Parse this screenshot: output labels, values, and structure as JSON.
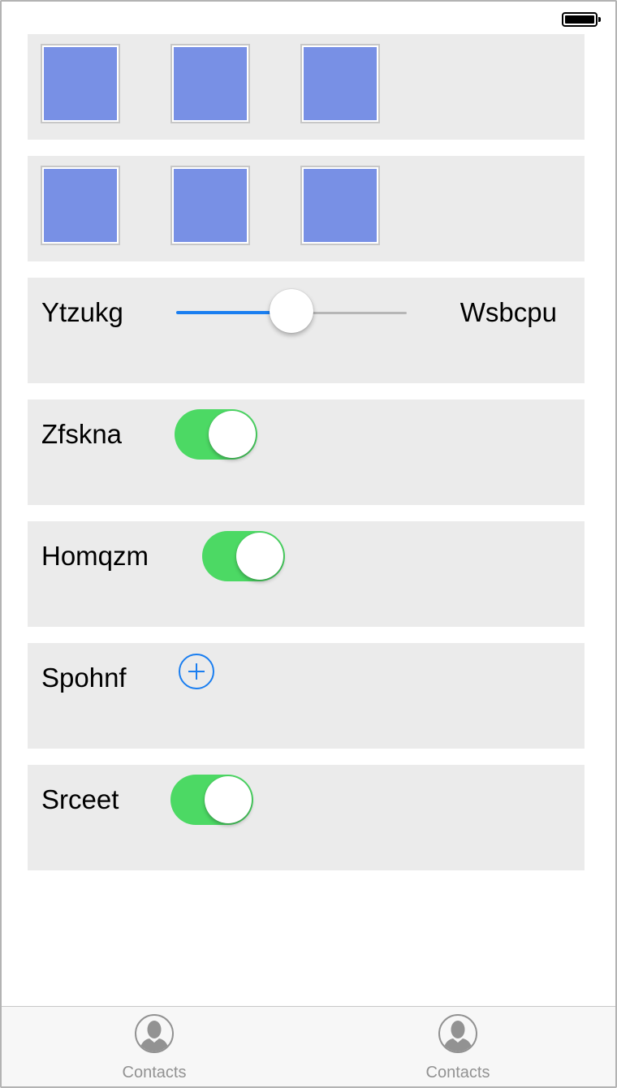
{
  "colors": {
    "tile_fill": "#7890e5",
    "toggle_on": "#4cd964",
    "accent_blue": "#1a7ef0",
    "row_background": "#ebebeb",
    "tab_inactive": "#929292"
  },
  "tile_rows": [
    {
      "tiles": [
        "tile",
        "tile",
        "tile"
      ]
    },
    {
      "tiles": [
        "tile",
        "tile",
        "tile"
      ]
    }
  ],
  "slider_row": {
    "label_left": "Ytzukg",
    "label_right": "Wsbcpu",
    "value": 0.5
  },
  "toggle_rows": [
    {
      "label": "Zfskna",
      "on": true
    },
    {
      "label": "Homqzm",
      "on": true
    }
  ],
  "add_row": {
    "label": "Spohnf",
    "icon": "plus-circle-icon"
  },
  "last_toggle_row": {
    "label": "Srceet",
    "on": true
  },
  "tab_bar": {
    "items": [
      {
        "label": "Contacts",
        "icon": "contact-person-icon"
      },
      {
        "label": "Contacts",
        "icon": "contact-person-icon"
      }
    ]
  }
}
